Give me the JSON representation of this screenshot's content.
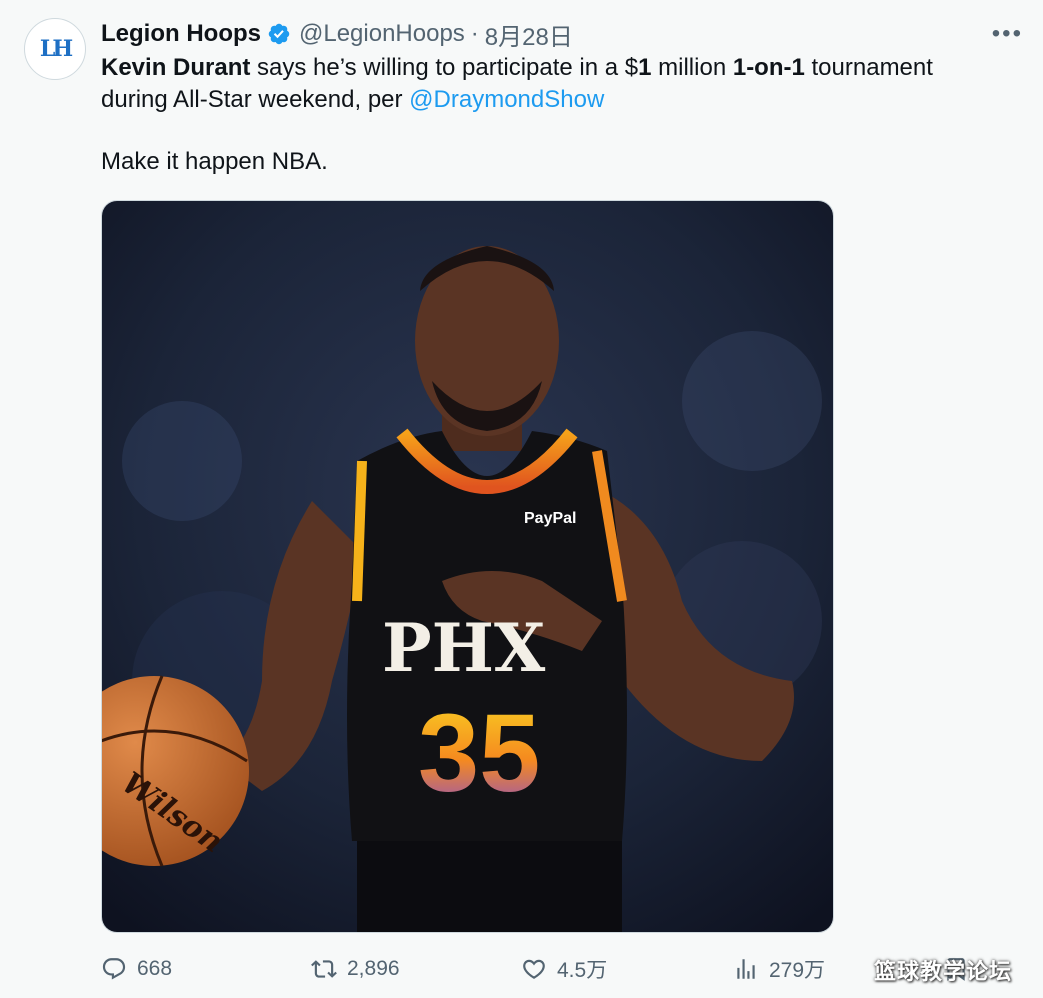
{
  "author": {
    "name": "Legion Hoops",
    "handle": "@LegionHoops",
    "separator": "·",
    "date": "8月28日",
    "avatar_text": "LH",
    "avatar_icon": "legion-hoops-logo"
  },
  "tweet": {
    "line1_bold1": "Kevin Durant",
    "line1_text1": " says he’s willing to participate in a $",
    "line1_bold2": "1",
    "line1_text2": " million ",
    "line1_bold3": "1-on-1",
    "line1_text3": " tournament",
    "line2_text": "during All-Star weekend, per ",
    "mention": "@DraymondShow",
    "line3_text": "Make it happen NBA."
  },
  "media": {
    "jersey_brand": "PayPal",
    "jersey_team": "PHX",
    "jersey_number": "35",
    "ball_brand": "Wilson"
  },
  "actions": {
    "replies": "668",
    "retweets": "2,896",
    "likes": "4.5万",
    "views": "279万"
  },
  "watermark": "篮球教学论坛",
  "colors": {
    "link": "#1d9bf0",
    "secondary_text": "#536471",
    "background": "#f7f9f9"
  }
}
